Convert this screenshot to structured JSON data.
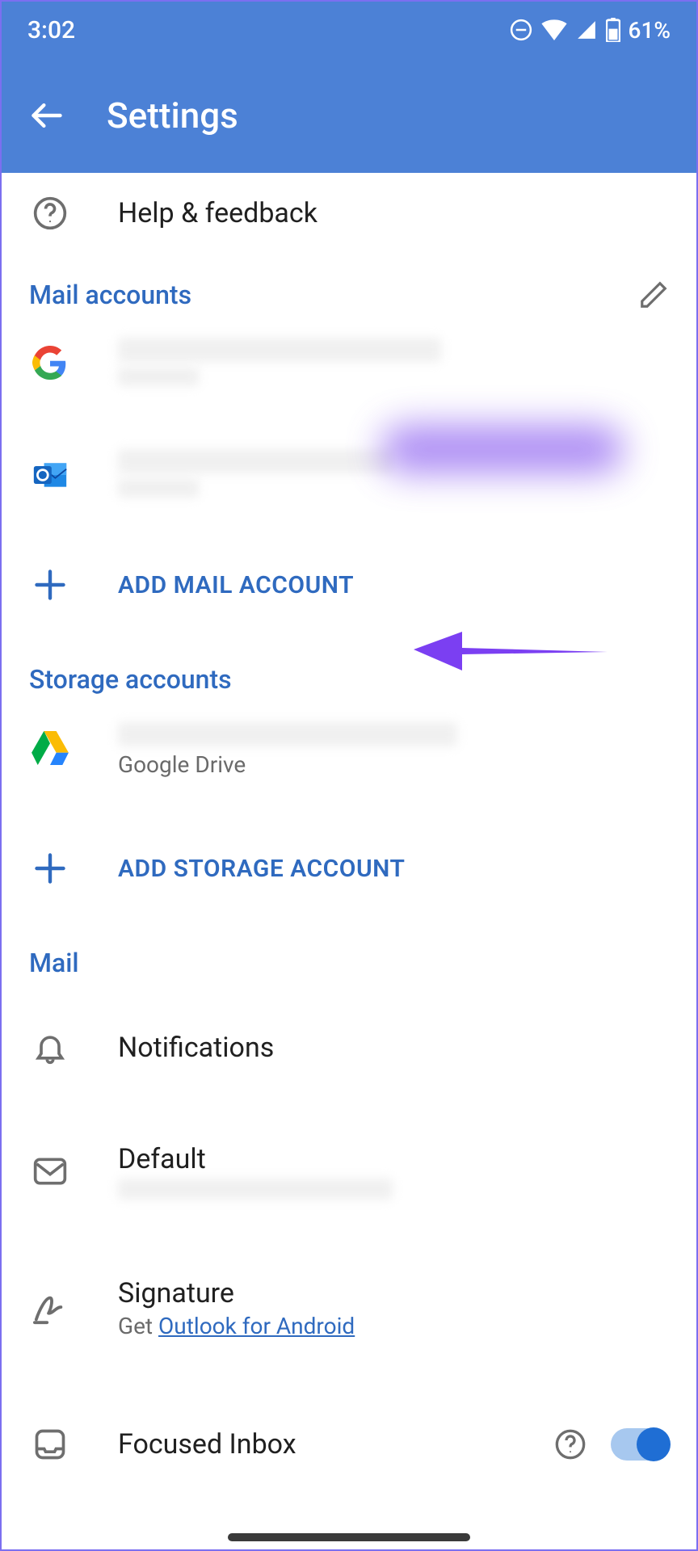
{
  "statusbar": {
    "time": "3:02",
    "battery": "61%"
  },
  "appbar": {
    "title": "Settings"
  },
  "help": {
    "label": "Help & feedback"
  },
  "sections": {
    "mail_accounts": "Mail accounts",
    "storage_accounts": "Storage accounts",
    "mail": "Mail"
  },
  "add_mail": "ADD MAIL ACCOUNT",
  "storage_item_sub": "Google Drive",
  "add_storage": "ADD STORAGE ACCOUNT",
  "settings": {
    "notifications": "Notifications",
    "default": "Default",
    "signature_title": "Signature",
    "signature_prefix": "Get ",
    "signature_link": "Outlook for Android",
    "focused": "Focused Inbox"
  }
}
